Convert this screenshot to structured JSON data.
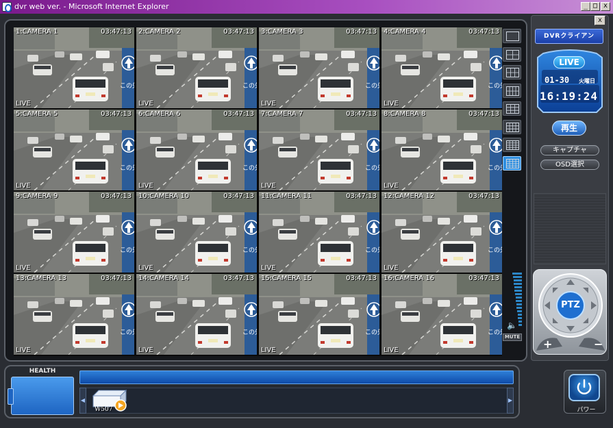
{
  "window": {
    "title": "dvr web ver. - Microsoft Internet Explorer",
    "minimize": "_",
    "maximize": "□",
    "close": "x"
  },
  "cameras": [
    {
      "name": "1:CAMERA 1",
      "time": "03:47:13",
      "status": "LIVE"
    },
    {
      "name": "2:CAMERA 2",
      "time": "03:47:13",
      "status": "LIVE"
    },
    {
      "name": "3:CAMERA 3",
      "time": "03:47:13",
      "status": "LIVE"
    },
    {
      "name": "4:CAMERA 4",
      "time": "03:47:13",
      "status": "LIVE"
    },
    {
      "name": "5:CAMERA 5",
      "time": "03:47:13",
      "status": "LIVE"
    },
    {
      "name": "6:CAMERA 6",
      "time": "03:47:13",
      "status": "LIVE"
    },
    {
      "name": "7:CAMERA 7",
      "time": "03:47:13",
      "status": "LIVE"
    },
    {
      "name": "8:CAMERA 8",
      "time": "03:47:13",
      "status": "LIVE"
    },
    {
      "name": "9:CAMERA 9",
      "time": "03:47:13",
      "status": "LIVE"
    },
    {
      "name": "10:CAMERA 10",
      "time": "03:47:13",
      "status": "LIVE"
    },
    {
      "name": "11:CAMERA 11",
      "time": "03:47:13",
      "status": "LIVE"
    },
    {
      "name": "12:CAMERA 12",
      "time": "03:47:13",
      "status": "LIVE"
    },
    {
      "name": "13:CAMERA 13",
      "time": "03:47:13",
      "status": "LIVE"
    },
    {
      "name": "14:CAMERA 14",
      "time": "03:47:13",
      "status": "LIVE"
    },
    {
      "name": "15:CAMERA 15",
      "time": "03:47:13",
      "status": "LIVE"
    },
    {
      "name": "16:CAMERA 16",
      "time": "03:47:13",
      "status": "LIVE"
    }
  ],
  "sign_text": "この先",
  "selected_camera": 1,
  "layouts": [
    "layout-1",
    "layout-4",
    "layout-6",
    "layout-8",
    "layout-9",
    "layout-10",
    "layout-13",
    "layout-16"
  ],
  "active_layout": "layout-16",
  "volume_segments": 16,
  "mute_label": "MUTE",
  "panel": {
    "brand": "DVRクライアン",
    "live": "LIVE",
    "date": "01-30",
    "weekday": "火曜日",
    "clock": "16:19:24",
    "play": "再生",
    "capture": "キャプチャ",
    "osd": "OSD選択",
    "close": "x"
  },
  "ptz": {
    "label": "PTZ",
    "zoom_in": "+",
    "zoom_out": "−"
  },
  "bottom": {
    "health_label": "HEALTH",
    "device_label": "W507",
    "power_label": "パワー"
  },
  "colors": {
    "accent": "#1a86d8",
    "selected_outline": "#2a43c8",
    "title_bar": "#7a1a8c"
  }
}
